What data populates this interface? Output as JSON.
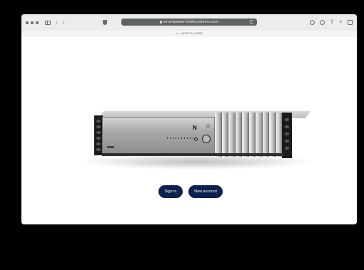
{
  "browser": {
    "url": "smartpower.listeksystems.com",
    "tab_title": "eSWITCH | WEB",
    "nav_back": "‹",
    "nav_forward": "›",
    "icons": [
      "traffic-lights",
      "sidebar-icon",
      "back-icon",
      "forward-icon",
      "shield-icon",
      "lock-icon",
      "reload-icon",
      "download-icon",
      "cloud-icon",
      "share-icon",
      "new-tab-icon",
      "tab-overview-icon"
    ],
    "right_icons": {
      "share": "⇪",
      "new_tab": "+"
    }
  },
  "page": {
    "device": {
      "brand_mark": "N",
      "power_mark": "⏻"
    },
    "buttons": {
      "sign_in": "Sign in",
      "new_account": "New account"
    }
  },
  "colors": {
    "button_bg": "#0d2150",
    "button_text": "#ffffff"
  }
}
